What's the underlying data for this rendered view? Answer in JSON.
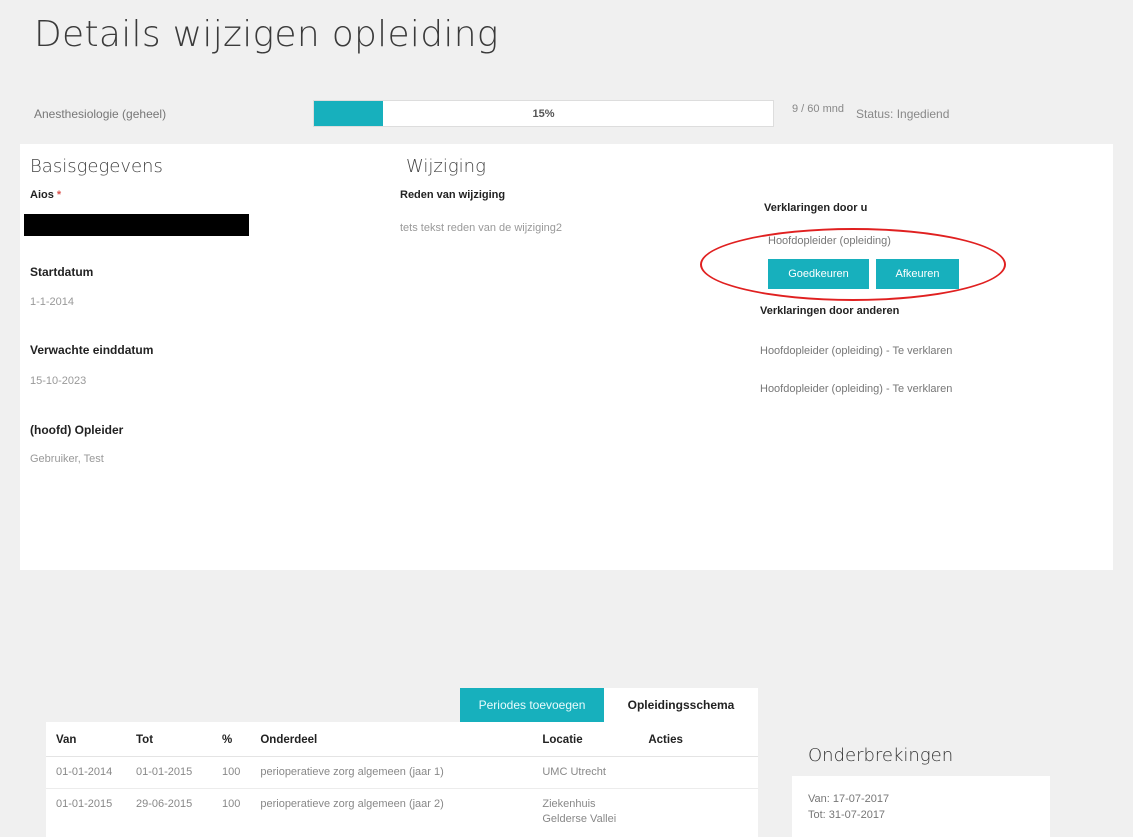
{
  "title": "Details wijzigen opleiding",
  "progress": {
    "label": "Anesthesiologie (geheel)",
    "percent": 15,
    "percent_text": "15%",
    "months": "9 / 60 mnd",
    "status": "Status: Ingediend"
  },
  "basis": {
    "title": "Basisgegevens",
    "aios_label": "Aios",
    "required_mark": "*",
    "startdatum_label": "Startdatum",
    "startdatum": "1-1-2014",
    "einddatum_label": "Verwachte einddatum",
    "einddatum": "15-10-2023",
    "opleider_label": "(hoofd) Opleider",
    "opleider": "Gebruiker, Test"
  },
  "wijziging": {
    "title": "Wijziging",
    "reden_label": "Reden van wijziging",
    "reden": "tets tekst reden van de wijziging2"
  },
  "verklaringen": {
    "own_title": "Verklaringen door u",
    "own_role": "Hoofdopleider (opleiding)",
    "approve_label": "Goedkeuren",
    "reject_label": "Afkeuren",
    "others_title": "Verklaringen door anderen",
    "others": [
      "Hoofdopleider (opleiding) - Te verklaren",
      "Hoofdopleider (opleiding) - Te verklaren"
    ]
  },
  "tabs": {
    "add_periods": "Periodes toevoegen",
    "schema": "Opleidingsschema"
  },
  "table": {
    "headers": [
      "Van",
      "Tot",
      "%",
      "Onderdeel",
      "Locatie",
      "Acties"
    ],
    "rows": [
      [
        "01-01-2014",
        "01-01-2015",
        "100",
        "perioperatieve zorg algemeen (jaar 1)",
        "UMC Utrecht",
        ""
      ],
      [
        "01-01-2015",
        "29-06-2015",
        "100",
        "perioperatieve zorg algemeen (jaar 2)",
        "Ziekenhuis Gelderse Vallei",
        ""
      ]
    ]
  },
  "onderbrekingen": {
    "title": "Onderbrekingen",
    "van": "Van: 17-07-2017",
    "tot": "Tot: 31-07-2017"
  },
  "colors": {
    "accent": "#17b0bd",
    "annotation": "#e02020"
  }
}
